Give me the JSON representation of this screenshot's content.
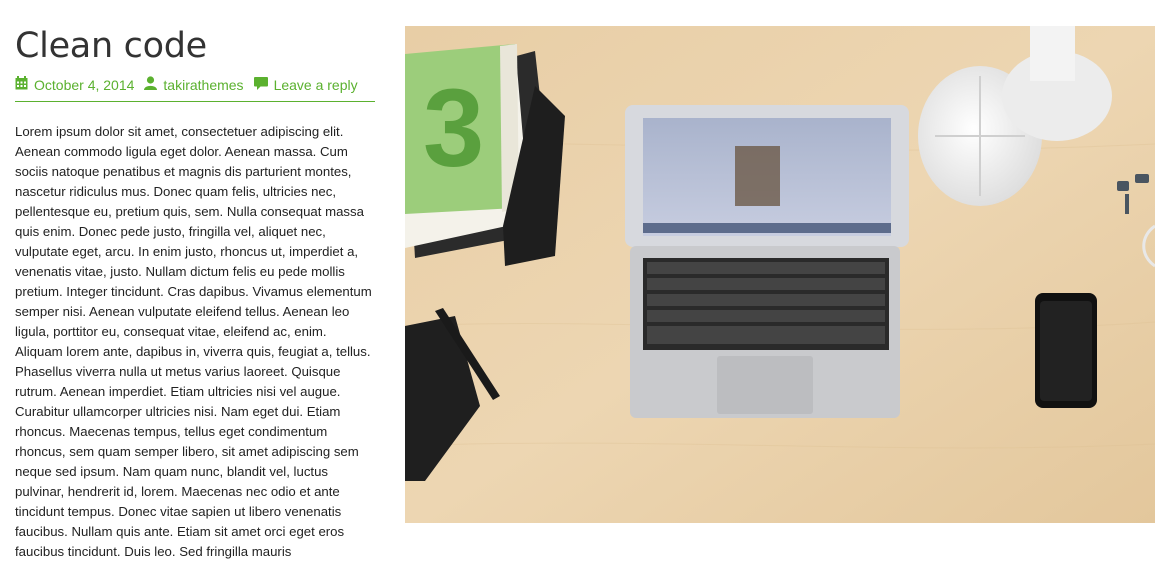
{
  "post": {
    "title": "Clean code",
    "meta": {
      "date": "October 4, 2014",
      "author": "takirathemes",
      "comments": "Leave a reply"
    },
    "body": "Lorem ipsum dolor sit amet, consectetuer adipiscing elit. Aenean commodo ligula eget dolor. Aenean massa. Cum sociis natoque penatibus et magnis dis parturient montes, nascetur ridiculus mus. Donec quam felis, ultricies nec, pellentesque eu, pretium quis, sem. Nulla consequat massa quis enim. Donec pede justo, fringilla vel, aliquet nec, vulputate eget, arcu. In enim justo, rhoncus ut, imperdiet a, venenatis vitae, justo. Nullam dictum felis eu pede mollis pretium. Integer tincidunt. Cras dapibus. Vivamus elementum semper nisi. Aenean vulputate eleifend tellus. Aenean leo ligula, porttitor eu, consequat vitae, eleifend ac, enim. Aliquam lorem ante, dapibus in, viverra quis, feugiat a, tellus. Phasellus viverra nulla ut metus varius laoreet. Quisque rutrum. Aenean imperdiet. Etiam ultricies nisi vel augue. Curabitur ullamcorper ultricies nisi. Nam eget dui. Etiam rhoncus. Maecenas tempus, tellus eget condimentum rhoncus, sem quam semper libero, sit amet adipiscing sem neque sed ipsum. Nam quam nunc, blandit vel, luctus pulvinar, hendrerit id, lorem. Maecenas nec odio et ante tincidunt tempus. Donec vitae sapien ut libero venenatis faucibus. Nullam quis ante. Etiam sit amet orci eget eros faucibus tincidunt. Duis leo. Sed fringilla mauris"
  },
  "icons": {
    "date": "calendar-icon",
    "author": "user-icon",
    "comments": "comment-icon"
  },
  "colors": {
    "accent": "#5bb12f",
    "text": "#222222",
    "title": "#333333"
  }
}
